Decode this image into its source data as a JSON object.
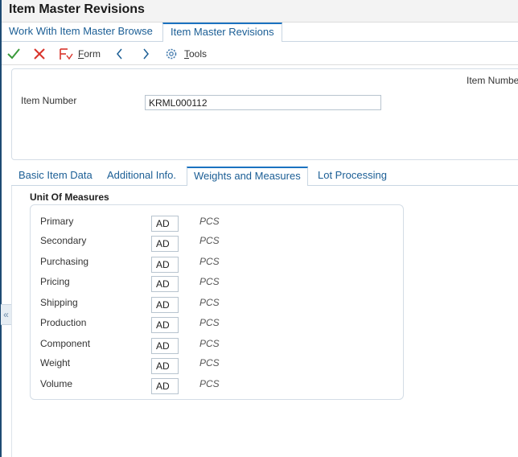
{
  "window": {
    "title": "Item Master Revisions"
  },
  "breadcrumbs": [
    {
      "label": "Work With Item Master Browse"
    },
    {
      "label": "Item Master Revisions"
    }
  ],
  "toolbar": {
    "form_menu": {
      "prefix": "F",
      "rest": "orm"
    },
    "tools_menu": {
      "prefix": "T",
      "rest": "ools"
    }
  },
  "header": {
    "right_label": "Item Numbe",
    "item_number_label": "Item Number",
    "item_number_value": "KRML000112"
  },
  "tabs": [
    {
      "label": "Basic Item Data"
    },
    {
      "label": "Additional Info."
    },
    {
      "label": "Weights and Measures"
    },
    {
      "label": "Lot Processing"
    }
  ],
  "unit_of_measures": {
    "title": "Unit Of Measures",
    "rows": [
      {
        "label": "Primary",
        "code": "AD",
        "desc": "PCS"
      },
      {
        "label": "Secondary",
        "code": "AD",
        "desc": "PCS"
      },
      {
        "label": "Purchasing",
        "code": "AD",
        "desc": "PCS"
      },
      {
        "label": "Pricing",
        "code": "AD",
        "desc": "PCS"
      },
      {
        "label": "Shipping",
        "code": "AD",
        "desc": "PCS"
      },
      {
        "label": "Production",
        "code": "AD",
        "desc": "PCS"
      },
      {
        "label": "Component",
        "code": "AD",
        "desc": "PCS"
      },
      {
        "label": "Weight",
        "code": "AD",
        "desc": "PCS"
      },
      {
        "label": "Volume",
        "code": "AD",
        "desc": "PCS"
      }
    ]
  },
  "colors": {
    "accent": "#1b72c0",
    "link": "#1b5e95",
    "ok_check": "#3a9a3a",
    "cancel_x": "#d9342b"
  }
}
